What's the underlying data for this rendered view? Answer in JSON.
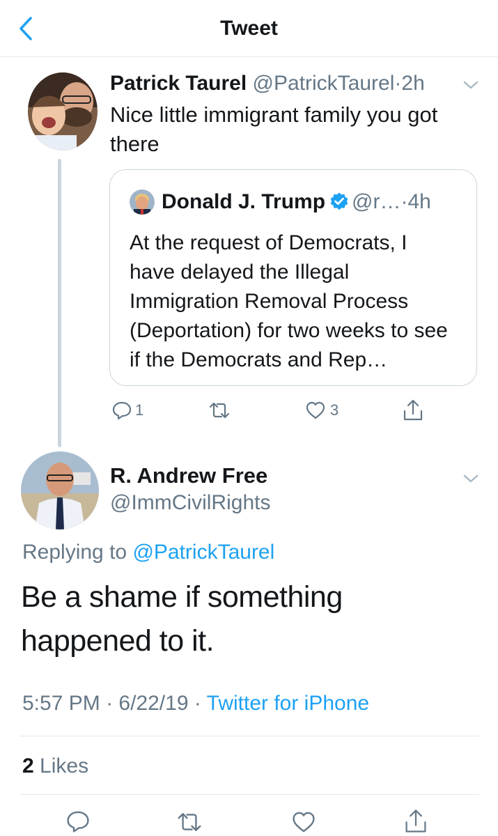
{
  "header": {
    "title": "Tweet"
  },
  "tweet1": {
    "name": "Patrick Taurel",
    "handle": "@PatrickTaurel",
    "sep": "·",
    "time": "2h",
    "text": "Nice little immigrant family you got there",
    "quote": {
      "name": "Donald J. Trump",
      "handle": "@r…",
      "sep": "·",
      "time": "4h",
      "text": "At the request of Democrats, I have delayed the Illegal Immigration Removal Process (Deportation) for two weeks to see if the Democrats and Rep…"
    },
    "actions": {
      "reply_count": "1",
      "like_count": "3"
    }
  },
  "tweet2": {
    "name": "R. Andrew Free",
    "handle": "@ImmCivilRights",
    "replying_prefix": "Replying to",
    "replying_to": "@PatrickTaurel",
    "text": "Be a shame if something happened to it.",
    "time": "5:57 PM",
    "sep1": "·",
    "date": "6/22/19",
    "sep2": "·",
    "source": "Twitter for iPhone",
    "likes_count": "2",
    "likes_label": "Likes"
  },
  "colors": {
    "accent": "#1da1f2",
    "muted": "#657786",
    "text": "#14171a",
    "border": "#e1e8ed"
  }
}
